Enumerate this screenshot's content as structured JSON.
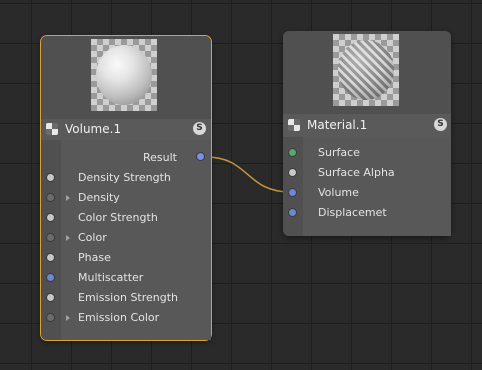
{
  "volume_node": {
    "title": "Volume.1",
    "badge": "S",
    "output": "Result",
    "inputs": [
      {
        "label": "Density Strength",
        "port": "white",
        "expandable": false
      },
      {
        "label": "Density",
        "port": "grey",
        "expandable": true
      },
      {
        "label": "Color Strength",
        "port": "white",
        "expandable": false
      },
      {
        "label": "Color",
        "port": "grey",
        "expandable": true
      },
      {
        "label": "Phase",
        "port": "white",
        "expandable": false
      },
      {
        "label": "Multiscatter",
        "port": "blue",
        "expandable": false
      },
      {
        "label": "Emission Strength",
        "port": "white",
        "expandable": false
      },
      {
        "label": "Emission Color",
        "port": "grey",
        "expandable": true
      }
    ]
  },
  "material_node": {
    "title": "Material.1",
    "badge": "S",
    "inputs": [
      {
        "label": "Surface",
        "port": "green"
      },
      {
        "label": "Surface Alpha",
        "port": "white"
      },
      {
        "label": "Volume",
        "port": "blue"
      },
      {
        "label": "Displacemet",
        "port": "blue"
      }
    ]
  },
  "colors": {
    "selection": "#d9a13a",
    "wire": "#c8963e",
    "port_blue": "#6f86d8",
    "port_green": "#59a86b"
  }
}
